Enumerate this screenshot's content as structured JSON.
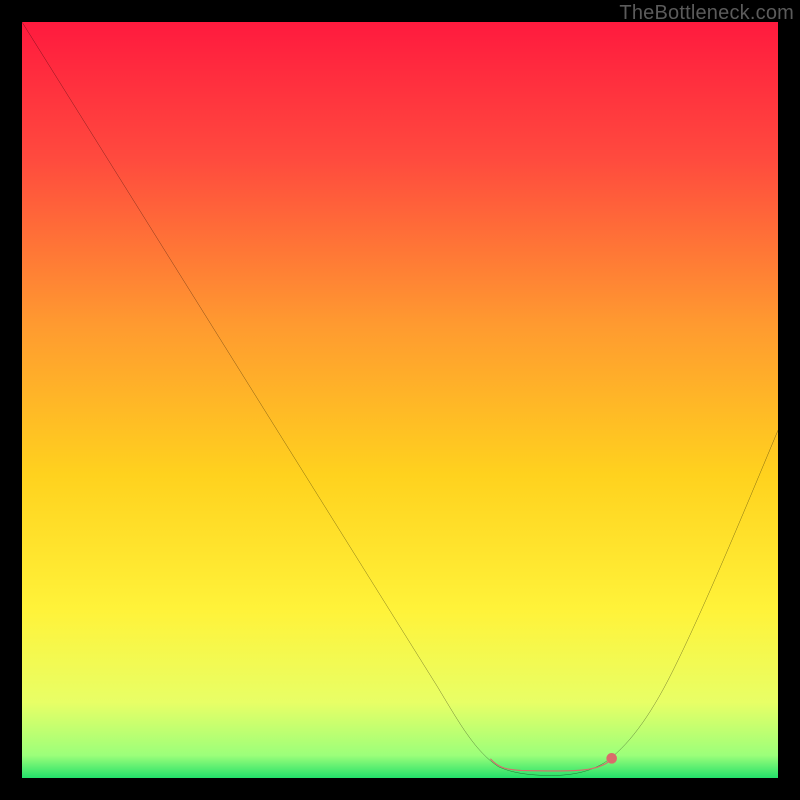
{
  "watermark": "TheBottleneck.com",
  "chart_data": {
    "type": "line",
    "title": "",
    "xlabel": "",
    "ylabel": "",
    "xlim": [
      0,
      100
    ],
    "ylim": [
      0,
      100
    ],
    "grid": false,
    "series": [
      {
        "name": "bottleneck-curve",
        "x": [
          0,
          5,
          10,
          15,
          20,
          25,
          30,
          35,
          40,
          45,
          50,
          55,
          60,
          65,
          70,
          75,
          80,
          85,
          90,
          95,
          100
        ],
        "y": [
          100,
          92,
          84,
          76,
          68,
          60,
          52,
          44,
          36,
          28,
          20,
          12,
          5,
          1,
          0,
          0,
          3,
          10,
          20,
          32,
          46
        ],
        "color": "#000000"
      },
      {
        "name": "optimal-zone-marker",
        "x": [
          62,
          64,
          66,
          68,
          70,
          72,
          74,
          76,
          78
        ],
        "y": [
          2.5,
          1.5,
          1.2,
          1.1,
          1.0,
          1.1,
          1.2,
          1.5,
          2.5
        ],
        "color": "#d96b6b"
      }
    ],
    "background_gradient_stops": [
      {
        "pos": 0.0,
        "color": "#ff1a3e"
      },
      {
        "pos": 0.18,
        "color": "#ff4a3e"
      },
      {
        "pos": 0.4,
        "color": "#ff9a30"
      },
      {
        "pos": 0.6,
        "color": "#ffd21e"
      },
      {
        "pos": 0.78,
        "color": "#fff33a"
      },
      {
        "pos": 0.9,
        "color": "#e8ff66"
      },
      {
        "pos": 0.97,
        "color": "#9cff7a"
      },
      {
        "pos": 1.0,
        "color": "#23e06a"
      }
    ]
  }
}
